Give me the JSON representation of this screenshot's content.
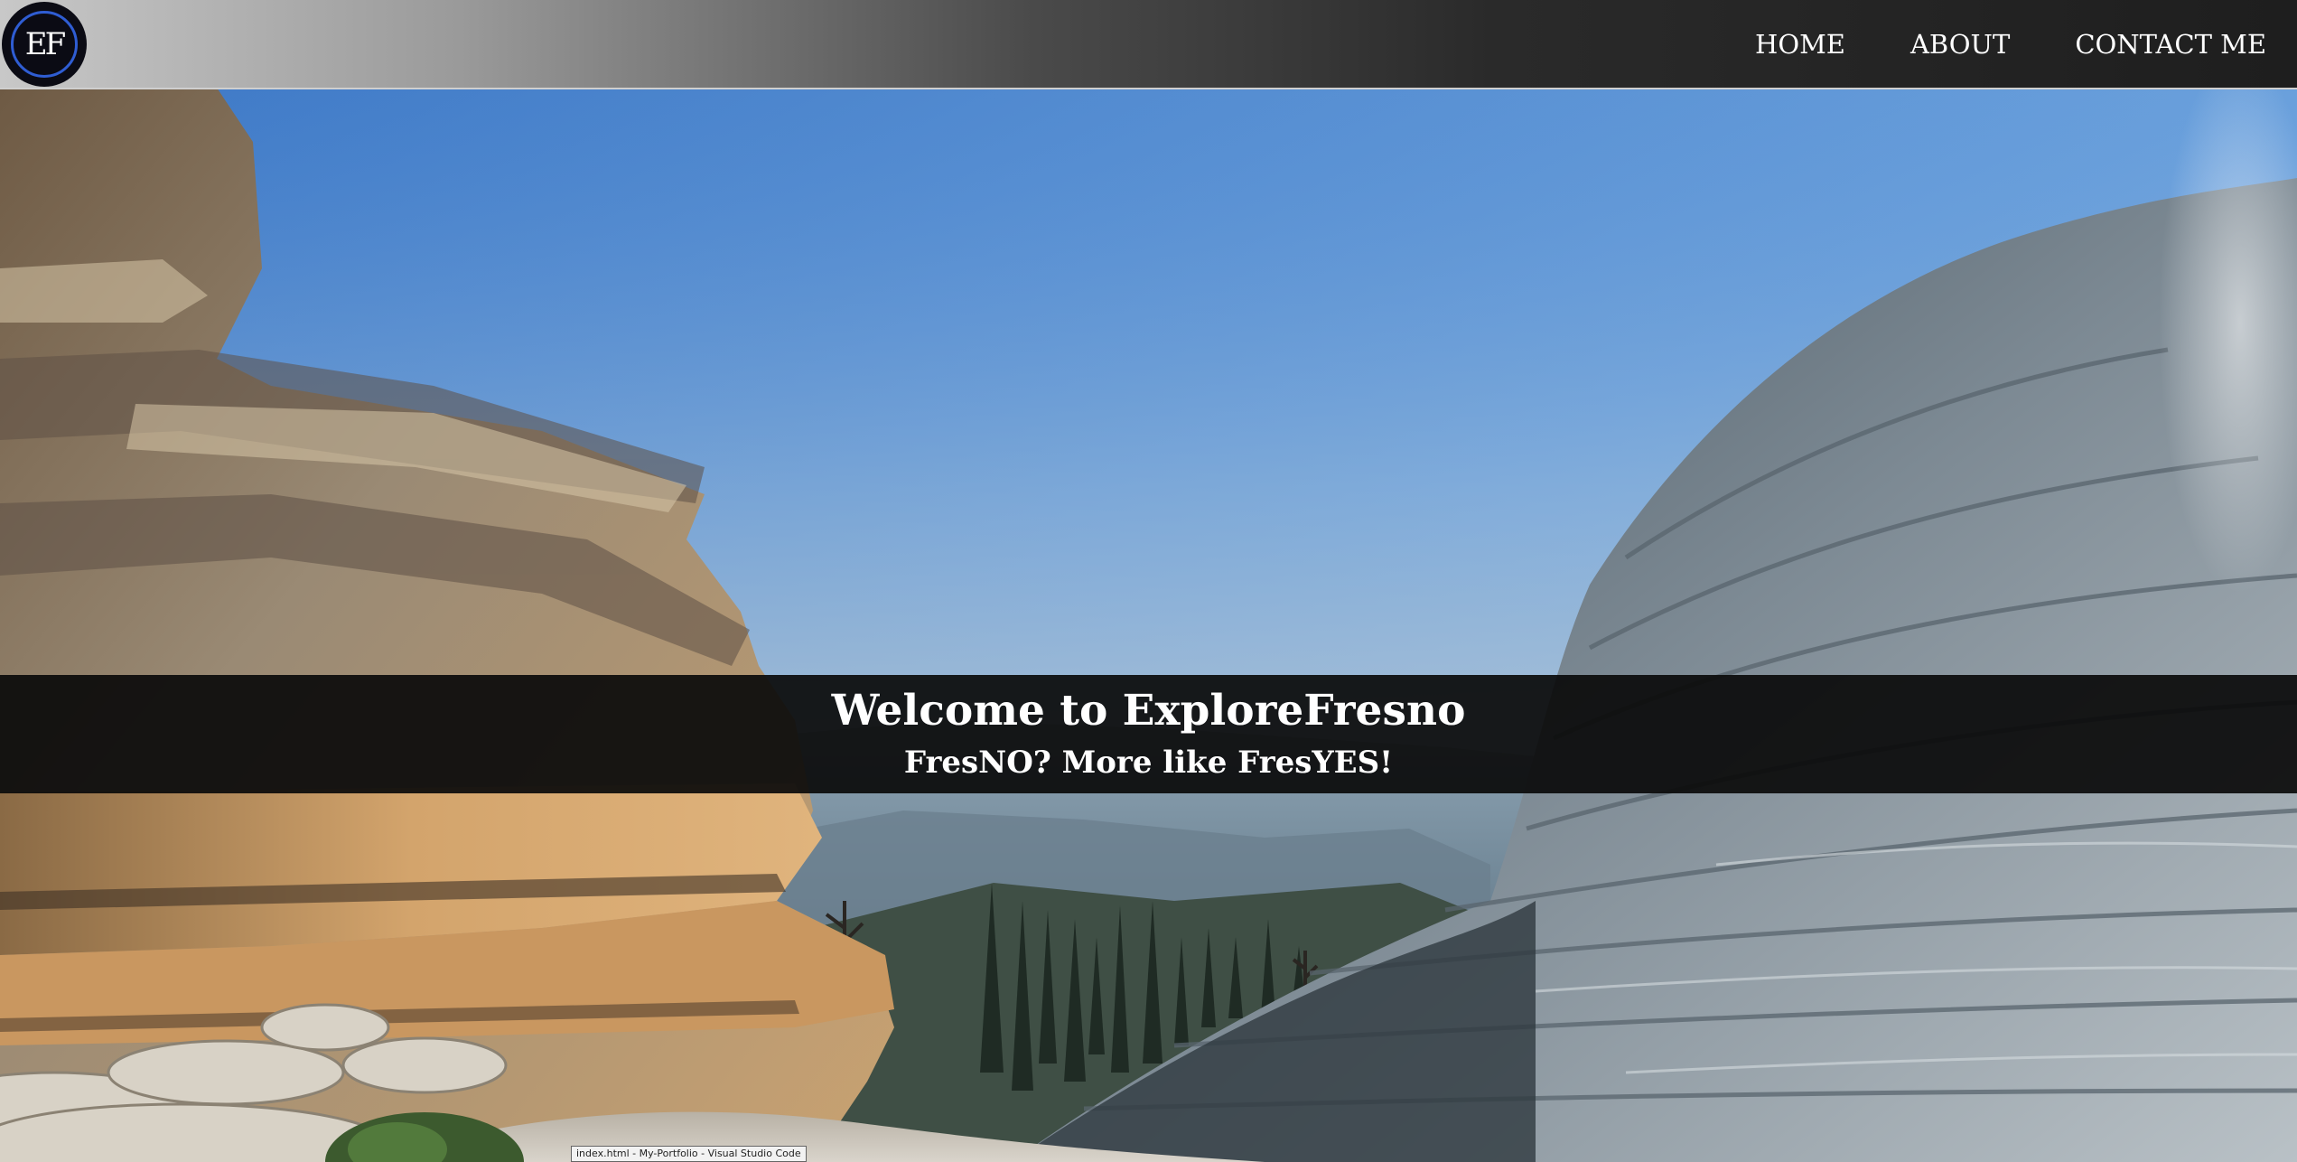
{
  "navbar": {
    "logo_text": "EF",
    "links": [
      {
        "label": "HOME"
      },
      {
        "label": "ABOUT"
      },
      {
        "label": "CONTACT ME"
      }
    ]
  },
  "hero": {
    "title": "Welcome to ExploreFresno",
    "subtitle": "FresNO? More like FresYES!"
  },
  "taskbar_tooltip": {
    "text": "index.html - My-Portfolio - Visual Studio Code"
  },
  "colors": {
    "banner_bg": "#0a0a0a",
    "logo_ring": "#2f5dd3",
    "nav_text": "#ffffff"
  }
}
